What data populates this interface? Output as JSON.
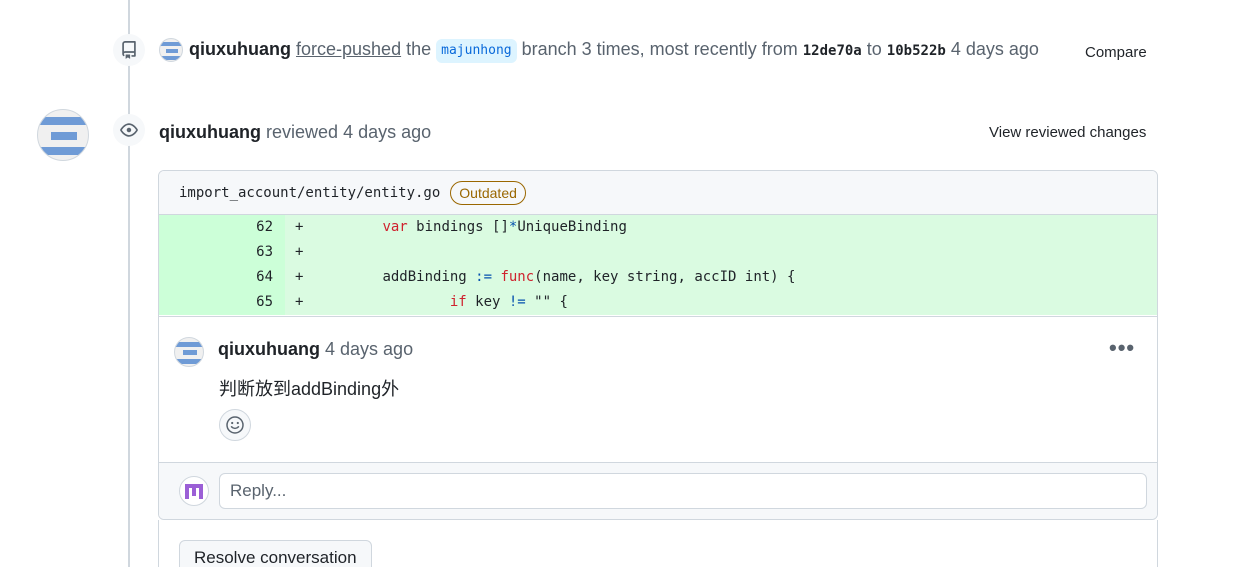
{
  "push_event": {
    "author": "qiuxuhuang",
    "action": "force-pushed",
    "the": "the",
    "branch": "majunhong",
    "middle": "branch 3 times, most recently from",
    "from_sha": "12de70a",
    "to_word": "to",
    "to_sha": "10b522b",
    "time": "4 days ago",
    "compare_label": "Compare"
  },
  "review": {
    "author": "qiuxuhuang",
    "action": "reviewed",
    "time": "4 days ago",
    "view_changes_label": "View reviewed changes"
  },
  "file": {
    "path": "import_account/entity/entity.go",
    "status": "Outdated"
  },
  "diff": [
    {
      "line": "62",
      "sign": "+",
      "indent": "\t",
      "parts": [
        {
          "t": "var",
          "c": "kw"
        },
        {
          "t": " bindings []"
        },
        {
          "t": "*",
          "c": "op"
        },
        {
          "t": "UniqueBinding"
        }
      ]
    },
    {
      "line": "63",
      "sign": "+",
      "indent": "",
      "parts": []
    },
    {
      "line": "64",
      "sign": "+",
      "indent": "\t",
      "parts": [
        {
          "t": "addBinding "
        },
        {
          "t": ":=",
          "c": "op"
        },
        {
          "t": " "
        },
        {
          "t": "func",
          "c": "kw"
        },
        {
          "t": "(name, key string, accID int) {"
        }
      ]
    },
    {
      "line": "65",
      "sign": "+",
      "indent": "\t\t",
      "parts": [
        {
          "t": "if",
          "c": "kw"
        },
        {
          "t": " key "
        },
        {
          "t": "!=",
          "c": "op"
        },
        {
          "t": " \"\" {"
        }
      ]
    }
  ],
  "comment": {
    "author": "qiuxuhuang",
    "time": "4 days ago",
    "body": "判断放到addBinding外",
    "more_label": "•••"
  },
  "reply": {
    "placeholder": "Reply..."
  },
  "resolve_label": "Resolve conversation",
  "colors": {
    "added_bg": "#dafbe1",
    "added_num_bg": "#ccffd8",
    "outdated": "#9a6700",
    "branch_bg": "#ddf4ff"
  }
}
